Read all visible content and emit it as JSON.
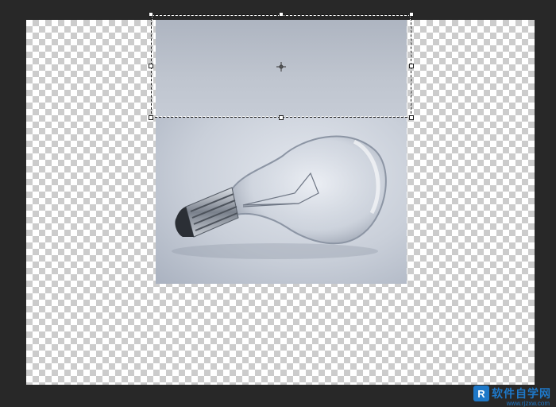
{
  "canvas": {
    "background": "transparency-checkerboard"
  },
  "photo": {
    "subject": "light-bulb-icon"
  },
  "selection": {
    "tool": "marquee"
  },
  "watermark": {
    "logo_letter": "R",
    "text": "软件自学网",
    "url": "www.rjzxw.com"
  },
  "colors": {
    "workspace": "#282828",
    "watermark": "#1e78c8"
  }
}
